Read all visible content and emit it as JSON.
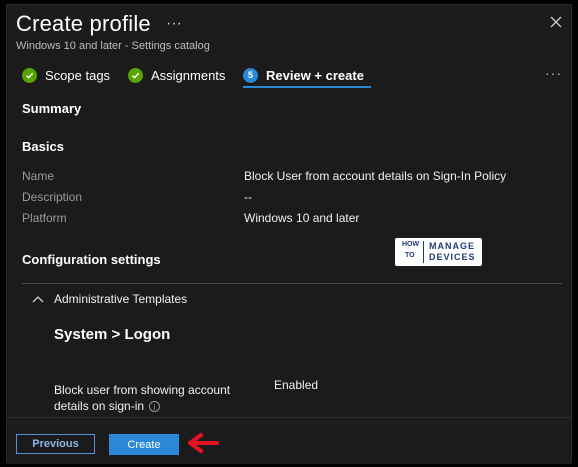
{
  "header": {
    "title": "Create profile",
    "more": "···",
    "subtitle": "Windows 10 and later - Settings catalog"
  },
  "steps": [
    {
      "label": "Scope tags",
      "state": "complete"
    },
    {
      "label": "Assignments",
      "state": "complete"
    },
    {
      "label": "Review + create",
      "state": "active",
      "number": "5"
    }
  ],
  "steps_more": "···",
  "summary": {
    "heading": "Summary",
    "basics_heading": "Basics",
    "rows": [
      {
        "label": "Name",
        "value": "Block User from account details on Sign-In Policy"
      },
      {
        "label": "Description",
        "value": "--"
      },
      {
        "label": "Platform",
        "value": "Windows 10 and later"
      }
    ],
    "config_heading": "Configuration settings",
    "logo": {
      "how": "HOW",
      "to": "TO",
      "manage": "MANAGE",
      "devices": "DEVICES"
    },
    "category": "Administrative Templates",
    "group_title": "System > Logon",
    "setting": {
      "label": "Block user from showing account details on sign-in",
      "value": "Enabled"
    }
  },
  "footer": {
    "previous_label": "Previous",
    "create_label": "Create"
  },
  "colors": {
    "accent": "#2b88d8",
    "success": "#57a300",
    "annotation_arrow": "#e81123"
  }
}
